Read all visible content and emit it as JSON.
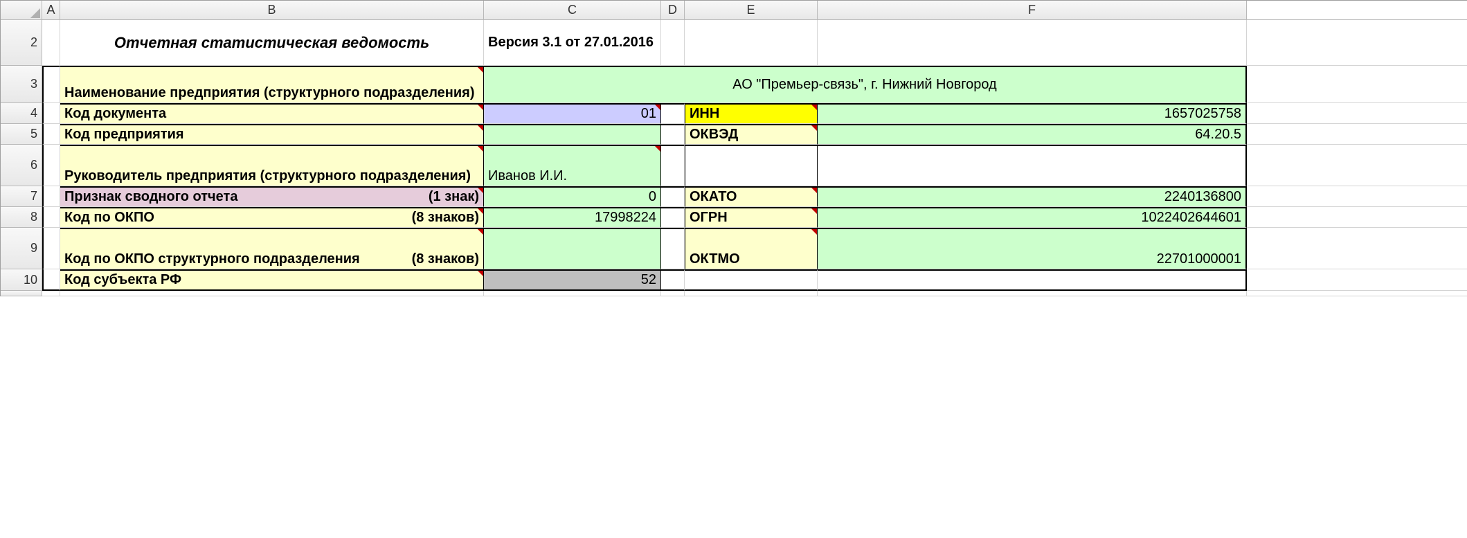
{
  "columns": {
    "A": "A",
    "B": "B",
    "C": "C",
    "D": "D",
    "E": "E",
    "F": "F"
  },
  "rowNums": {
    "r2": "2",
    "r3": "3",
    "r4": "4",
    "r5": "5",
    "r6": "6",
    "r7": "7",
    "r8": "8",
    "r9": "9",
    "r10": "10"
  },
  "title": "Отчетная  статистическая ведомость",
  "version": "Версия 3.1 от 27.01.2016",
  "labels": {
    "enterprise_name": "Наименование предприятия (структурного подразделения)",
    "doc_code": "Код документа",
    "enterprise_code": "Код предприятия",
    "head": "Руководитель предприятия (структурного подразделения)",
    "summary_flag": "Признак сводного отчета",
    "summary_flag_sz": "(1 знак)",
    "okpo": "Код по ОКПО",
    "okpo_sz": "(8 знаков)",
    "okpo_struct": "Код по ОКПО  структурного подразделения",
    "okpo_struct_sz": "(8 знаков)",
    "subject_rf": "Код субъекта РФ",
    "inn": "ИНН",
    "okved": "ОКВЭД",
    "okato": "ОКАТО",
    "ogrn": "ОГРН",
    "oktmo": "ОКТМО"
  },
  "values": {
    "enterprise_name": "АО \"Премьер-связь\", г. Нижний Новгород",
    "doc_code": "01",
    "enterprise_code": "",
    "head": "Иванов И.И.",
    "summary_flag": "0",
    "okpo": "17998224",
    "okpo_struct": "",
    "subject_rf": "52",
    "inn": "1657025758",
    "okved": "64.20.5",
    "okato": "2240136800",
    "ogrn": "1022402644601",
    "oktmo": "22701000001"
  }
}
